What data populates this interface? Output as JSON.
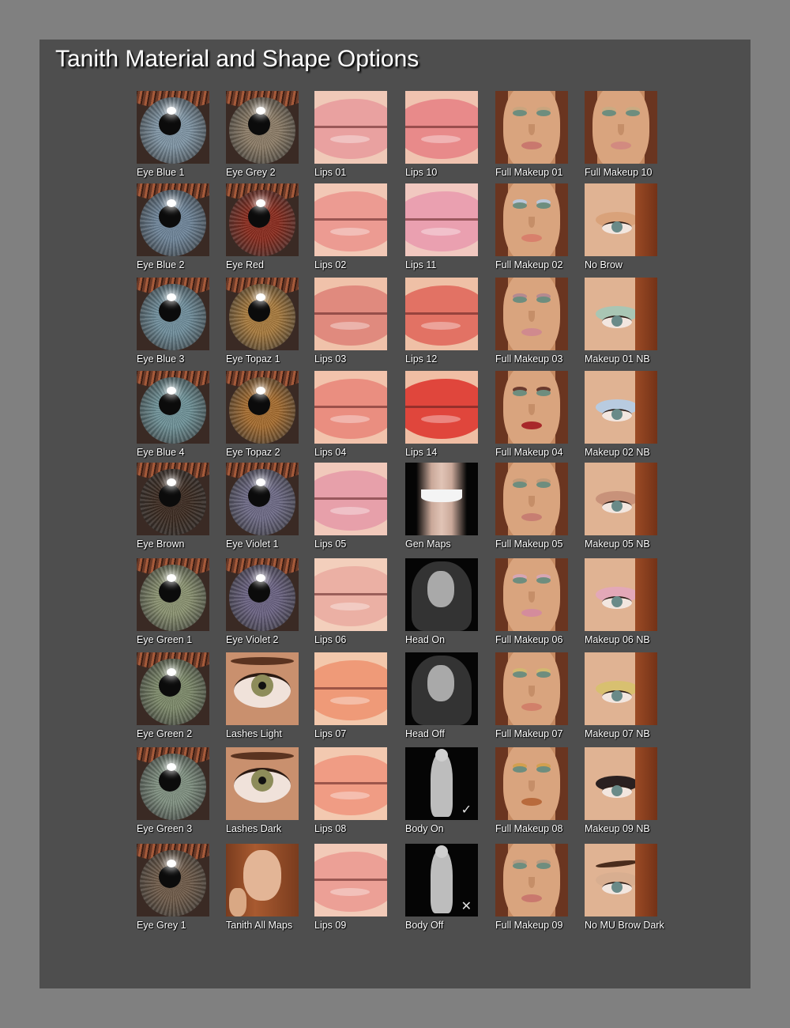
{
  "title": "Tanith Material and Shape Options",
  "columns": [
    {
      "kind": "eye",
      "items": [
        {
          "label": "Eye Blue 1",
          "color": "#7f95a5"
        },
        {
          "label": "Eye Blue 2",
          "color": "#6e859a"
        },
        {
          "label": "Eye Blue 3",
          "color": "#6f8e9c"
        },
        {
          "label": "Eye Blue 4",
          "color": "#6e9298"
        },
        {
          "label": "Eye Brown",
          "color": "#3b2a20"
        },
        {
          "label": "Eye Green 1",
          "color": "#8a9270"
        },
        {
          "label": "Eye Green 2",
          "color": "#7d8a6a"
        },
        {
          "label": "Eye Green 3",
          "color": "#7f9080"
        },
        {
          "label": "Eye Grey 1",
          "color": "#6e5a48"
        }
      ]
    },
    {
      "kind": "mixed",
      "items": [
        {
          "label": "Eye Grey 2",
          "kind": "eye",
          "color": "#8c7c66"
        },
        {
          "label": "Eye Red",
          "kind": "eye",
          "color": "#8a2a1c"
        },
        {
          "label": "Eye Topaz 1",
          "kind": "eye",
          "color": "#a87a3c"
        },
        {
          "label": "Eye Topaz 2",
          "kind": "eye",
          "color": "#a66c2e"
        },
        {
          "label": "Eye Violet 1",
          "kind": "eye",
          "color": "#6d6a86"
        },
        {
          "label": "Eye Violet 2",
          "kind": "eye",
          "color": "#6a6282"
        },
        {
          "label": "Lashes Light",
          "kind": "lashes"
        },
        {
          "label": "Lashes Dark",
          "kind": "lashes"
        },
        {
          "label": "Tanith All Maps",
          "kind": "allmaps"
        }
      ]
    },
    {
      "kind": "lips",
      "items": [
        {
          "label": "Lips 01",
          "color": "#e9a1a0",
          "bg": "#f0c9b8"
        },
        {
          "label": "Lips 02",
          "color": "#ec9b92",
          "bg": "#f2c8b6"
        },
        {
          "label": "Lips 03",
          "color": "#e08a7e",
          "bg": "#f0c2aa"
        },
        {
          "label": "Lips 04",
          "color": "#ea8e80",
          "bg": "#f2c3ac"
        },
        {
          "label": "Lips 05",
          "color": "#e7a0aa",
          "bg": "#f1c9bb"
        },
        {
          "label": "Lips 06",
          "color": "#ebb0a4",
          "bg": "#f3cfbc"
        },
        {
          "label": "Lips 07",
          "color": "#ef9a78",
          "bg": "#f3c8ac"
        },
        {
          "label": "Lips 08",
          "color": "#f09c84",
          "bg": "#f3c9b0"
        },
        {
          "label": "Lips 09",
          "color": "#eca096",
          "bg": "#f2cab8"
        }
      ]
    },
    {
      "kind": "mixed",
      "items": [
        {
          "label": "Lips 10",
          "kind": "lips",
          "color": "#e88a8a",
          "bg": "#f0c3b0"
        },
        {
          "label": "Lips 11",
          "kind": "lips",
          "color": "#eaa0b0",
          "bg": "#f1c8c0"
        },
        {
          "label": "Lips 12",
          "kind": "lips",
          "color": "#e27264",
          "bg": "#efc0a6"
        },
        {
          "label": "Lips 14",
          "kind": "lips",
          "color": "#e0463c",
          "bg": "#f0bea4"
        },
        {
          "label": "Gen Maps",
          "kind": "genmaps"
        },
        {
          "label": "Head On",
          "kind": "head"
        },
        {
          "label": "Head Off",
          "kind": "head"
        },
        {
          "label": "Body On",
          "kind": "body",
          "mark": "✓"
        },
        {
          "label": "Body Off",
          "kind": "body",
          "mark": "✕"
        }
      ]
    },
    {
      "kind": "face",
      "items": [
        {
          "label": "Full Makeup 01",
          "mouth": "#c9786e",
          "shadow": "#c9a57e"
        },
        {
          "label": "Full Makeup 02",
          "mouth": "#d8806c",
          "shadow": "#b9c6d8"
        },
        {
          "label": "Full Makeup 03",
          "mouth": "#d08a8e",
          "shadow": "#b48a90"
        },
        {
          "label": "Full Makeup 04",
          "mouth": "#a8282a",
          "shadow": "#6a3a2e"
        },
        {
          "label": "Full Makeup 05",
          "mouth": "#c77e72",
          "shadow": "#c29a78"
        },
        {
          "label": "Full Makeup 06",
          "mouth": "#d48c9c",
          "shadow": "#d6a6b4"
        },
        {
          "label": "Full Makeup 07",
          "mouth": "#d1806a",
          "shadow": "#d2b870"
        },
        {
          "label": "Full Makeup 08",
          "mouth": "#b86a3c",
          "shadow": "#d2a050"
        },
        {
          "label": "Full Makeup 09",
          "mouth": "#c9786e",
          "shadow": "#b89a80"
        }
      ]
    },
    {
      "kind": "mixed",
      "items": [
        {
          "label": "Full Makeup 10",
          "kind": "face",
          "mouth": "#d28a80",
          "shadow": "#c9ab82"
        },
        {
          "label": "No Brow",
          "kind": "closeup",
          "shadow": "#d9a27a",
          "brow": false
        },
        {
          "label": "Makeup 01 NB",
          "kind": "closeup",
          "shadow": "#a9c6b4",
          "brow": false
        },
        {
          "label": "Makeup 02 NB",
          "kind": "closeup",
          "shadow": "#b8cbe0",
          "brow": false
        },
        {
          "label": "Makeup 05 NB",
          "kind": "closeup",
          "shadow": "#c8927a",
          "brow": false
        },
        {
          "label": "Makeup 06 NB",
          "kind": "closeup",
          "shadow": "#e3a8b8",
          "brow": false
        },
        {
          "label": "Makeup 07 NB",
          "kind": "closeup",
          "shadow": "#d8c070",
          "brow": false
        },
        {
          "label": "Makeup 09 NB",
          "kind": "closeup",
          "shadow": "#2a2020",
          "brow": false
        },
        {
          "label": "No MU Brow Dark",
          "kind": "closeup",
          "shadow": "#d8ae90",
          "brow": true
        }
      ]
    }
  ]
}
